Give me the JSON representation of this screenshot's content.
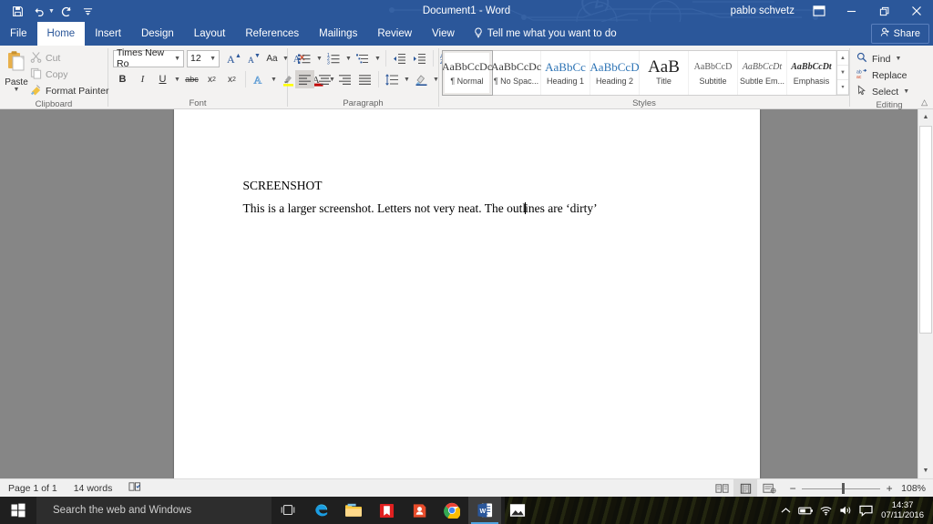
{
  "titlebar": {
    "document_title": "Document1  -  Word",
    "username": "pablo schvetz",
    "quick_access": [
      {
        "name": "save",
        "label": "Save"
      },
      {
        "name": "undo",
        "label": "Undo"
      },
      {
        "name": "redo",
        "label": "Redo"
      },
      {
        "name": "customize",
        "label": "Customize Quick Access Toolbar"
      }
    ],
    "window_controls": [
      {
        "name": "ribbon-display-options",
        "label": "Ribbon Display Options"
      },
      {
        "name": "minimize",
        "label": "Minimize",
        "glyph": "—"
      },
      {
        "name": "restore",
        "label": "Restore Down",
        "glyph": "❐"
      },
      {
        "name": "close",
        "label": "Close",
        "glyph": "✕"
      }
    ]
  },
  "tabs": [
    {
      "label": "File",
      "active": false
    },
    {
      "label": "Home",
      "active": true
    },
    {
      "label": "Insert",
      "active": false
    },
    {
      "label": "Design",
      "active": false
    },
    {
      "label": "Layout",
      "active": false
    },
    {
      "label": "References",
      "active": false
    },
    {
      "label": "Mailings",
      "active": false
    },
    {
      "label": "Review",
      "active": false
    },
    {
      "label": "View",
      "active": false
    }
  ],
  "tellme": {
    "label": "Tell me what you want to do"
  },
  "share": {
    "label": "Share"
  },
  "ribbon": {
    "clipboard": {
      "group_label": "Clipboard",
      "paste_label": "Paste",
      "items": [
        {
          "label": "Cut",
          "enabled": false
        },
        {
          "label": "Copy",
          "enabled": false
        },
        {
          "label": "Format Painter",
          "enabled": true
        }
      ]
    },
    "font": {
      "group_label": "Font",
      "font_name": "Times New Ro",
      "font_size": "12",
      "buttons": [
        {
          "name": "grow-font",
          "label": "A"
        },
        {
          "name": "shrink-font",
          "label": "A"
        },
        {
          "name": "change-case",
          "label": "Aa"
        },
        {
          "name": "clear-formatting",
          "label": "Clear All Formatting"
        },
        {
          "name": "bold",
          "label": "B"
        },
        {
          "name": "italic",
          "label": "I"
        },
        {
          "name": "underline",
          "label": "U"
        },
        {
          "name": "strikethrough",
          "label": "abc"
        },
        {
          "name": "subscript",
          "label": "x₂"
        },
        {
          "name": "superscript",
          "label": "x²"
        },
        {
          "name": "text-effects",
          "label": "A"
        },
        {
          "name": "text-highlight-color",
          "label": "ab",
          "color": "#ffff00"
        },
        {
          "name": "font-color",
          "label": "A",
          "color": "#c00000"
        }
      ]
    },
    "paragraph": {
      "group_label": "Paragraph",
      "buttons": [
        {
          "name": "bullets",
          "label": "Bullets"
        },
        {
          "name": "numbering",
          "label": "Numbering"
        },
        {
          "name": "multilevel-list",
          "label": "Multilevel List"
        },
        {
          "name": "decrease-indent",
          "label": "Decrease Indent"
        },
        {
          "name": "increase-indent",
          "label": "Increase Indent"
        },
        {
          "name": "sort",
          "label": "Sort"
        },
        {
          "name": "show-formatting-marks",
          "label": "¶"
        },
        {
          "name": "align-left",
          "label": "Align Left",
          "selected": true
        },
        {
          "name": "center",
          "label": "Center"
        },
        {
          "name": "align-right",
          "label": "Align Right"
        },
        {
          "name": "justify",
          "label": "Justify"
        },
        {
          "name": "line-spacing",
          "label": "Line and Paragraph Spacing"
        },
        {
          "name": "shading",
          "label": "Shading"
        },
        {
          "name": "borders",
          "label": "Borders"
        }
      ]
    },
    "styles": {
      "group_label": "Styles",
      "items": [
        {
          "preview": "AaBbCcDc",
          "name": "¶ Normal",
          "selected": true,
          "kind": "normal"
        },
        {
          "preview": "AaBbCcDc",
          "name": "¶ No Spac...",
          "selected": false,
          "kind": "nospacing"
        },
        {
          "preview": "AaBbCc",
          "name": "Heading 1",
          "selected": false,
          "kind": "h1"
        },
        {
          "preview": "AaBbCcD",
          "name": "Heading 2",
          "selected": false,
          "kind": "h2"
        },
        {
          "preview": "AaB",
          "name": "Title",
          "selected": false,
          "kind": "title"
        },
        {
          "preview": "AaBbCcD",
          "name": "Subtitle",
          "selected": false,
          "kind": "subtitle"
        },
        {
          "preview": "AaBbCcDt",
          "name": "Subtle Em...",
          "selected": false,
          "kind": "subtleem"
        },
        {
          "preview": "AaBbCcDt",
          "name": "Emphasis",
          "selected": false,
          "kind": "emphasis"
        }
      ]
    },
    "editing": {
      "group_label": "Editing",
      "items": [
        {
          "label": "Find",
          "icon": "search-icon",
          "caret": true
        },
        {
          "label": "Replace",
          "icon": "replace-icon",
          "caret": false
        },
        {
          "label": "Select",
          "icon": "select-icon",
          "caret": true
        }
      ]
    }
  },
  "document": {
    "heading": "SCREENSHOT",
    "body_before_caret": "This is a larger screenshot. Letters not very neat. The outl",
    "body_after_caret": "ines are ‘dirty’"
  },
  "statusbar": {
    "page": "Page 1 of 1",
    "words": "14 words",
    "proofing": "proofing-errors-icon",
    "views": [
      {
        "name": "read-mode",
        "label": "Read Mode",
        "active": false
      },
      {
        "name": "print-layout",
        "label": "Print Layout",
        "active": true
      },
      {
        "name": "web-layout",
        "label": "Web Layout",
        "active": false
      }
    ],
    "zoom_out": "−",
    "zoom_in": "+",
    "zoom_level": "108%"
  },
  "taskbar": {
    "search_placeholder": "Search the web and Windows",
    "icons": [
      {
        "name": "task-view-icon",
        "label": "Task View"
      },
      {
        "name": "edge-icon",
        "label": "Microsoft Edge"
      },
      {
        "name": "file-explorer-icon",
        "label": "File Explorer"
      },
      {
        "name": "store-book-icon",
        "label": "Reader"
      },
      {
        "name": "red-app-icon",
        "label": "Mail"
      },
      {
        "name": "chrome-icon",
        "label": "Google Chrome"
      },
      {
        "name": "word-icon",
        "label": "Word",
        "active": true
      },
      {
        "name": "photos-icon",
        "label": "Photos"
      }
    ],
    "tray": [
      {
        "name": "show-hidden-icons",
        "glyph": "∧"
      },
      {
        "name": "battery-icon"
      },
      {
        "name": "wifi-icon"
      },
      {
        "name": "volume-icon"
      },
      {
        "name": "action-center-icon"
      }
    ],
    "time": "14:37",
    "date": "07/11/2016"
  },
  "colors": {
    "word_blue": "#2b579a",
    "ribbon_bg": "#f3f2f1",
    "workspace_gray": "#868686",
    "accent_blue": "#2e74b5"
  }
}
